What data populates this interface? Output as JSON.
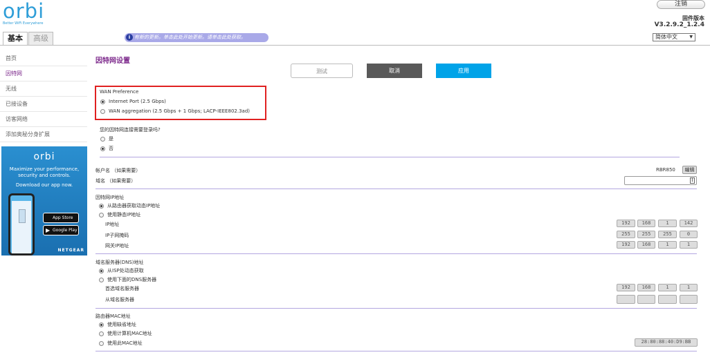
{
  "header": {
    "logo_text": "orbi",
    "logo_tagline": "Better WiFi Everywhere",
    "logout_label": "注销",
    "firmware_label": "固件版本",
    "firmware_version": "V3.2.9.2_1.2.4",
    "tabs": [
      {
        "label": "基本",
        "active": true
      },
      {
        "label": "高级",
        "active": false
      }
    ],
    "notice_icon": "i",
    "notice_text": "有新的更新。单击此处开始更新。请单击此处获取。",
    "language": "简体中文"
  },
  "sidebar": {
    "items": [
      {
        "label": "首页"
      },
      {
        "label": "因特网",
        "active": true
      },
      {
        "label": "无线"
      },
      {
        "label": "已接设备"
      },
      {
        "label": "访客网络"
      },
      {
        "label": "添加奥秘分身扩展"
      }
    ],
    "promo": {
      "logo": "orbi",
      "line1": "Maximize your performance, security and controls.",
      "line2": "Download our app now.",
      "appstore_small": "Download on the",
      "appstore": "App Store",
      "googleplay_small": "GET IT ON",
      "googleplay": "Google Play",
      "brand": "NETGEAR"
    }
  },
  "main": {
    "title": "因特网设置",
    "buttons": {
      "test": "测试",
      "cancel": "取消",
      "apply": "应用"
    },
    "wan": {
      "heading": "WAN Preference",
      "opt1": "Internet Port (2.5 Gbps)",
      "opt2": "WAN aggregation (2.5 Gbps + 1 Gbps; LACP-IEEE802.3ad)",
      "selected": "opt1"
    },
    "login": {
      "question": "您的因特网连接需要登录吗?",
      "yes": "是",
      "no": "否",
      "selected": "no"
    },
    "account": {
      "label": "帐户名 （如果需要）",
      "value": "RBR850",
      "edit": "编辑"
    },
    "domain": {
      "label": "域名 （如果需要）",
      "value": ""
    },
    "ip": {
      "heading": "因特网IP地址",
      "dynamic": "从路由器获取动态IP地址",
      "static": "使用静态IP地址",
      "ip_label": "IP地址",
      "ip": [
        "192",
        "168",
        "1",
        "142"
      ],
      "mask_label": "IP子网掩码",
      "mask": [
        "255",
        "255",
        "255",
        "0"
      ],
      "gw_label": "网关IP地址",
      "gw": [
        "192",
        "168",
        "1",
        "1"
      ]
    },
    "dns": {
      "heading": "域名服务器(DNS)地址",
      "auto": "从ISP处动态获取",
      "manual": "使用下面的DNS服务器",
      "primary_label": "首选域名服务器",
      "primary": [
        "192",
        "168",
        "1",
        "1"
      ],
      "secondary_label": "从域名服务器",
      "secondary": [
        "",
        "",
        "",
        ""
      ]
    },
    "mac": {
      "heading": "路由器MAC地址",
      "default": "使用缺省地址",
      "computer": "使用计算机MAC地址",
      "custom": "使用此MAC地址",
      "value": "28:80:88:40:D9:BB"
    }
  }
}
